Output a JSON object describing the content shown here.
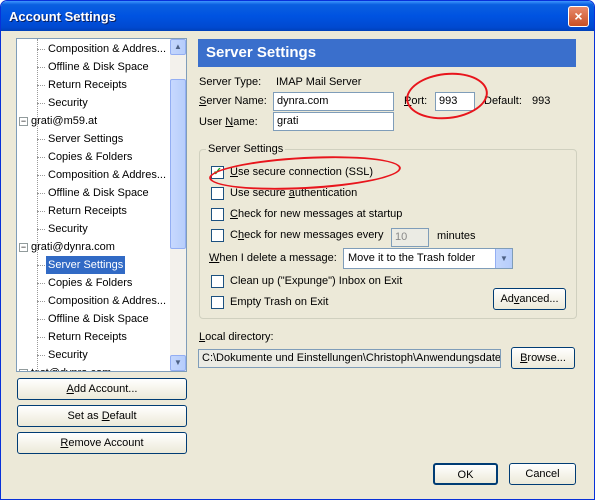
{
  "window": {
    "title": "Account Settings",
    "close_glyph": "×"
  },
  "tree": {
    "items": [
      {
        "label": "Composition & Addresses",
        "display": "Composition & Addres...",
        "level": 2
      },
      {
        "label": "Offline & Disk Space",
        "level": 2
      },
      {
        "label": "Return Receipts",
        "level": 2
      },
      {
        "label": "Security",
        "level": 2
      },
      {
        "label": "grati@m59.at",
        "level": 1
      },
      {
        "label": "Server Settings",
        "level": 2
      },
      {
        "label": "Copies & Folders",
        "level": 2
      },
      {
        "label": "Composition & Addresses",
        "display": "Composition & Addres...",
        "level": 2
      },
      {
        "label": "Offline & Disk Space",
        "level": 2
      },
      {
        "label": "Return Receipts",
        "level": 2
      },
      {
        "label": "Security",
        "level": 2
      },
      {
        "label": "grati@dynra.com",
        "level": 1
      },
      {
        "label": "Server Settings",
        "level": 2,
        "selected": true
      },
      {
        "label": "Copies & Folders",
        "level": 2
      },
      {
        "label": "Composition & Addresses",
        "display": "Composition & Addres...",
        "level": 2
      },
      {
        "label": "Offline & Disk Space",
        "level": 2
      },
      {
        "label": "Return Receipts",
        "level": 2
      },
      {
        "label": "Security",
        "level": 2
      },
      {
        "label": "test@dynra.com",
        "level": 1
      }
    ],
    "expander_glyph": "−"
  },
  "left_buttons": {
    "add_account": {
      "pre": "",
      "u": "A",
      "post": "dd Account..."
    },
    "set_default": {
      "pre": "Set as ",
      "u": "D",
      "post": "efault"
    },
    "remove_account": {
      "pre": "",
      "u": "R",
      "post": "emove Account"
    }
  },
  "panel": {
    "header": "Server Settings",
    "server_type_label": "Server Type:",
    "server_type_value": "IMAP Mail Server",
    "server_name_label": {
      "pre": "",
      "u": "S",
      "post": "erver Name:"
    },
    "server_name_value": "dynra.com",
    "port_label": {
      "pre": "",
      "u": "P",
      "post": "ort:"
    },
    "port_value": "993",
    "default_label": "Default:",
    "default_value": "993",
    "user_name_label": {
      "pre": "User ",
      "u": "N",
      "post": "ame:"
    },
    "user_name_value": "grati"
  },
  "server_settings_group": {
    "title": "Server Settings",
    "checkboxes": [
      {
        "pre": "",
        "u": "U",
        "post": "se secure connection (SSL)",
        "checked": true
      },
      {
        "pre": "Use secure ",
        "u": "a",
        "post": "uthentication",
        "checked": false
      },
      {
        "pre": "",
        "u": "C",
        "post": "heck for new messages at startup",
        "checked": false
      },
      {
        "pre": "C",
        "u": "h",
        "post": "eck for new messages every",
        "checked": false
      }
    ],
    "check_glyph": "✓",
    "minutes_value": "10",
    "minutes_label": "minutes",
    "delete_label": {
      "pre": "",
      "u": "W",
      "post": "hen I delete a message:"
    },
    "delete_select_value": "Move it to the Trash folder",
    "select_arrow_glyph": "▼",
    "cleanup_label": "Clean up (\"Expunge\") Inbox on Exit",
    "cleanup_checked": false,
    "empty_trash_label": "Empty Trash on Exit",
    "empty_trash_checked": false,
    "advanced_button": {
      "pre": "Ad",
      "u": "v",
      "post": "anced..."
    }
  },
  "local_directory": {
    "label": {
      "pre": "",
      "u": "L",
      "post": "ocal directory:"
    },
    "value": "C:\\Dokumente und Einstellungen\\Christoph\\Anwendungsdaten",
    "browse_button": {
      "pre": "",
      "u": "B",
      "post": "rowse..."
    }
  },
  "dialog_buttons": {
    "ok": "OK",
    "cancel": "Cancel"
  },
  "scrollbar": {
    "up_glyph": "▲",
    "down_glyph": "▼"
  },
  "annotation_color": "#e8151c"
}
